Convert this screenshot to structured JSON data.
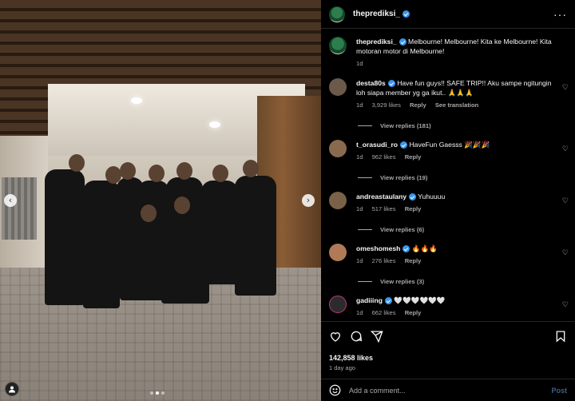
{
  "post": {
    "username": "theprediksi_",
    "caption": "Melbourne! Melbourne! Kita ke Melbourne! Kita motoran motor di Melbourne!",
    "caption_age": "1d",
    "likes": "142,858 likes",
    "date": "1 day ago"
  },
  "icons": {
    "more": "more-options-icon",
    "heart": "heart-icon",
    "comment": "comment-icon",
    "share": "share-icon",
    "save": "bookmark-icon",
    "emoji": "emoji-icon",
    "prev": "chevron-left-icon",
    "next": "chevron-right-icon",
    "tag": "user-tag-icon"
  },
  "comments": [
    {
      "user": "desta80s",
      "text": "Have fun guys!! SAFE TRIP!! Aku sampe ngitungin loh siapa member yg ga ikut.. 🙏🙏🙏",
      "age": "1d",
      "likes": "3,929 likes",
      "reply": "Reply",
      "translate": "See translation",
      "view_replies": "View replies (181)"
    },
    {
      "user": "t_orasudi_ro",
      "text": "HaveFun Gaesss 🎉🎉🎉",
      "age": "1d",
      "likes": "962 likes",
      "reply": "Reply",
      "view_replies": "View replies (19)"
    },
    {
      "user": "andreastaulany",
      "text": "Yuhuuuu",
      "age": "1d",
      "likes": "517 likes",
      "reply": "Reply",
      "view_replies": "View replies (6)"
    },
    {
      "user": "omeshomesh",
      "text": "🔥🔥🔥",
      "age": "1d",
      "likes": "276 likes",
      "reply": "Reply",
      "view_replies": "View replies (3)"
    },
    {
      "user": "gadiiing",
      "text": "🤍🤍🤍🤍🤍🤍",
      "age": "1d",
      "likes": "662 likes",
      "reply": "Reply"
    }
  ],
  "comment_box": {
    "placeholder": "Add a comment...",
    "post_label": "Post"
  },
  "carousel": {
    "prev_glyph": "‹",
    "next_glyph": "›",
    "slide_count": 3,
    "active_slide": 2
  },
  "colors": {
    "verified": "#3897f0",
    "post_button": "#3f5f88",
    "secondary_text": "#a8a8a8"
  }
}
